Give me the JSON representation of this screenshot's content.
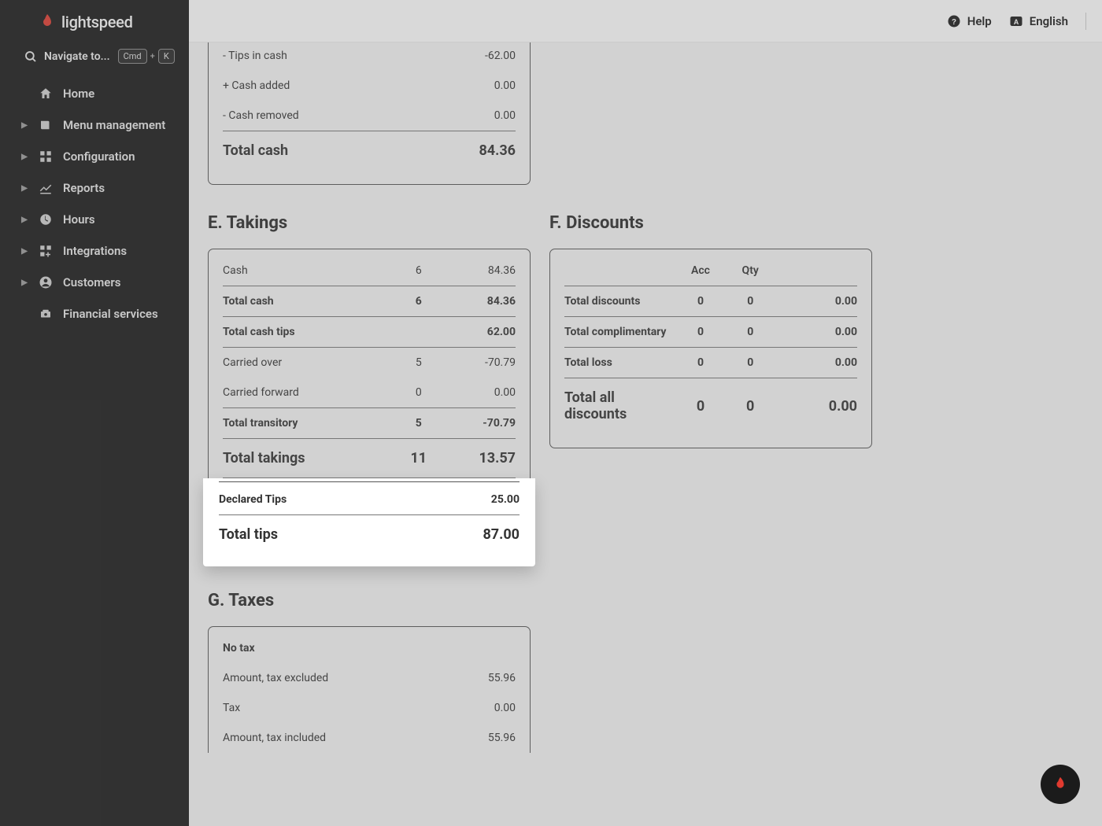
{
  "brand": {
    "name": "lightspeed"
  },
  "search": {
    "label": "Navigate to...",
    "keys": {
      "cmd": "Cmd",
      "plus": "+",
      "k": "K"
    }
  },
  "sidebar": {
    "items": [
      {
        "label": "Home",
        "icon": "home",
        "expandable": false
      },
      {
        "label": "Menu management",
        "icon": "menu",
        "expandable": true
      },
      {
        "label": "Configuration",
        "icon": "grid",
        "expandable": true
      },
      {
        "label": "Reports",
        "icon": "reports",
        "expandable": true
      },
      {
        "label": "Hours",
        "icon": "clock",
        "expandable": true
      },
      {
        "label": "Integrations",
        "icon": "integrations",
        "expandable": true
      },
      {
        "label": "Customers",
        "icon": "user",
        "expandable": true
      },
      {
        "label": "Financial services",
        "icon": "bank",
        "expandable": false
      }
    ]
  },
  "topbar": {
    "help": "Help",
    "language": "English"
  },
  "cash_card": {
    "rows": [
      {
        "label": "- Tips in cash",
        "value": "-62.00"
      },
      {
        "label": "+ Cash added",
        "value": "0.00"
      },
      {
        "label": "- Cash removed",
        "value": "0.00"
      }
    ],
    "total": {
      "label": "Total cash",
      "value": "84.36"
    }
  },
  "section_e": {
    "title": "E. Takings",
    "rows": [
      {
        "label": "Cash",
        "qty": "6",
        "value": "84.36",
        "bold": false
      },
      {
        "label": "Total cash",
        "qty": "6",
        "value": "84.36",
        "bold": true,
        "divider": true
      },
      {
        "label": "Total cash tips",
        "qty": "",
        "value": "62.00",
        "bold": true,
        "divider": true
      },
      {
        "label": "Carried over",
        "qty": "5",
        "value": "-70.79",
        "bold": false,
        "divider": true
      },
      {
        "label": "Carried forward",
        "qty": "0",
        "value": "0.00",
        "bold": false
      },
      {
        "label": "Total transitory",
        "qty": "5",
        "value": "-70.79",
        "bold": true,
        "divider": true
      },
      {
        "label": "Total takings",
        "qty": "11",
        "value": "13.57",
        "bold": true,
        "big": true,
        "divider": true
      }
    ],
    "highlight": [
      {
        "label": "Declared Tips",
        "value": "25.00",
        "bold": true,
        "divider": true
      },
      {
        "label": "Total tips",
        "value": "87.00",
        "bold": true,
        "big": true,
        "divider": true
      }
    ]
  },
  "section_f": {
    "title": "F. Discounts",
    "headers": {
      "acc": "Acc",
      "qty": "Qty"
    },
    "rows": [
      {
        "label": "Total discounts",
        "acc": "0",
        "qty": "0",
        "value": "0.00"
      },
      {
        "label": "Total complimentary",
        "acc": "0",
        "qty": "0",
        "value": "0.00"
      },
      {
        "label": "Total loss",
        "acc": "0",
        "qty": "0",
        "value": "0.00"
      }
    ],
    "total": {
      "label": "Total all discounts",
      "acc": "0",
      "qty": "0",
      "value": "0.00"
    }
  },
  "section_g": {
    "title": "G. Taxes",
    "header": {
      "label": "No tax"
    },
    "rows": [
      {
        "label": "Amount, tax excluded",
        "value": "55.96"
      },
      {
        "label": "Tax",
        "value": "0.00"
      },
      {
        "label": "Amount, tax included",
        "value": "55.96"
      }
    ]
  }
}
